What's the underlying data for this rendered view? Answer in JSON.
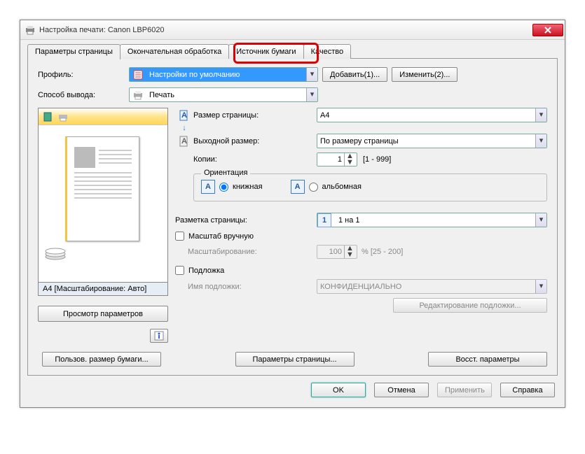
{
  "window": {
    "title": "Настройка печати: Canon LBP6020"
  },
  "tabs": {
    "items": [
      {
        "label": "Параметры страницы"
      },
      {
        "label": "Окончательная обработка"
      },
      {
        "label": "Источник бумаги"
      },
      {
        "label": "Качество"
      }
    ]
  },
  "profile": {
    "label": "Профиль:",
    "value": "Настройки по умолчанию",
    "add_btn": "Добавить(1)...",
    "edit_btn": "Изменить(2)..."
  },
  "output_method": {
    "label": "Способ вывода:",
    "value": "Печать"
  },
  "preview": {
    "caption": "A4 [Масштабирование: Авто]",
    "view_params_btn": "Просмотр параметров"
  },
  "page_size": {
    "label": "Размер страницы:",
    "value": "A4"
  },
  "output_size": {
    "label": "Выходной размер:",
    "value": "По размеру страницы"
  },
  "copies": {
    "label": "Копии:",
    "value": "1",
    "range": "[1 - 999]"
  },
  "orientation": {
    "legend": "Ориентация",
    "portrait": "книжная",
    "landscape": "альбомная"
  },
  "layout": {
    "label": "Разметка страницы:",
    "value": "1 на 1",
    "icon_text": "1"
  },
  "manual_scale": {
    "checkbox": "Масштаб вручную",
    "scale_label": "Масштабирование:",
    "value": "100",
    "range": "% [25 - 200]"
  },
  "watermark": {
    "checkbox": "Подложка",
    "name_label": "Имя подложки:",
    "value": "КОНФИДЕНЦИАЛЬНО",
    "edit_btn": "Редактирование подложки..."
  },
  "bottom": {
    "custom_size": "Пользов. размер бумаги...",
    "page_params": "Параметры страницы...",
    "restore": "Восст. параметры"
  },
  "dialog": {
    "ok": "OK",
    "cancel": "Отмена",
    "apply": "Применить",
    "help": "Справка"
  }
}
